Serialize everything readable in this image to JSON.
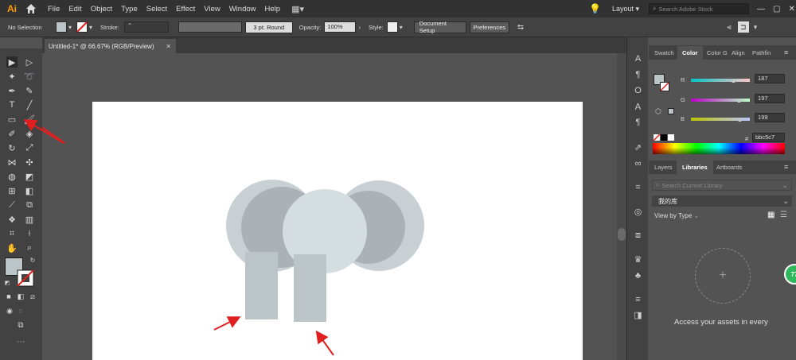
{
  "app": {
    "logo": "Ai"
  },
  "menu": [
    "File",
    "Edit",
    "Object",
    "Type",
    "Select",
    "Effect",
    "View",
    "Window",
    "Help"
  ],
  "workspace": {
    "label": "Layout",
    "search_placeholder": "Search Adobe Stock"
  },
  "control": {
    "selection": "No Selection",
    "stroke_label": "Stroke:",
    "brush": "3 pt. Round",
    "opacity_label": "Opacity:",
    "opacity_value": "100%",
    "style_label": "Style:",
    "doc_setup": "Document Setup",
    "preferences": "Preferences"
  },
  "document": {
    "tab_title": "Untitled-1* @ 66.67% (RGB/Preview)"
  },
  "color_panel": {
    "tabs": [
      "Swatch",
      "Color",
      "Color G",
      "Align",
      "Pathfin"
    ],
    "r_label": "R",
    "g_label": "G",
    "b_label": "B",
    "r": "187",
    "g": "197",
    "b": "199",
    "hex_label": "#",
    "hex": "bbc5c7"
  },
  "libraries_panel": {
    "tabs": [
      "Layers",
      "Libraries",
      "Artboards"
    ],
    "search_placeholder": "Search Current Library",
    "library_name": "我的库",
    "view_by": "View by Type",
    "access_text": "Access your assets in every"
  },
  "badge": "77",
  "colors": {
    "accent": "#ff9a00",
    "shape_light": "#c8d0d4",
    "shape_mid": "#aab2b6",
    "shape_front": "#d4dde0",
    "rect": "#bbc5c7",
    "arrow": "#e02020"
  }
}
